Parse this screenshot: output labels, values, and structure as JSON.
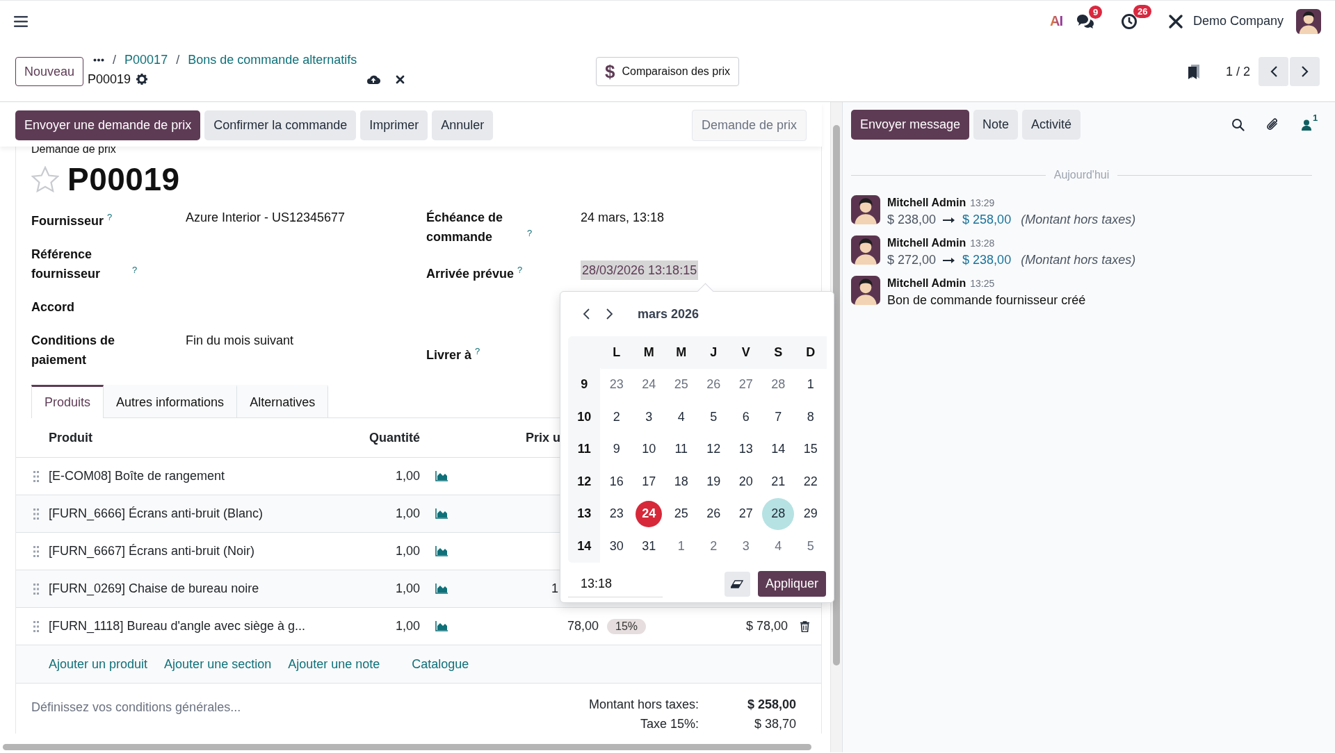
{
  "navbar": {
    "ai_label": "AI",
    "messages_badge": "9",
    "activities_badge": "26",
    "company": "Demo Company"
  },
  "control_panel": {
    "new_button": "Nouveau",
    "breadcrumbs": [
      {
        "kind": "separator",
        "label": "/"
      },
      {
        "kind": "link",
        "label": "P00017"
      },
      {
        "kind": "separator",
        "label": "/"
      },
      {
        "kind": "link",
        "label": "Bons de commande alternatifs"
      }
    ],
    "record_name": "P00019",
    "comparison_button": {
      "icon": "$",
      "label": "Comparaison des prix"
    },
    "pager": "1 / 2"
  },
  "actions": {
    "buttons": [
      {
        "label": "Envoyer une demande de prix",
        "primary": true
      },
      {
        "label": "Confirmer la commande",
        "primary": false
      },
      {
        "label": "Imprimer",
        "primary": false
      },
      {
        "label": "Annuler",
        "primary": false
      }
    ],
    "status": "Demande de prix"
  },
  "form": {
    "state_label": "Demande de prix",
    "starred": false,
    "name": "P00019",
    "fields_left": [
      {
        "label": "Fournisseur",
        "help": "?",
        "value": "Azure Interior - US12345677",
        "focused": false
      },
      {
        "label": "Référence fournisseur",
        "help": "?"
      },
      {
        "label": "Accord"
      },
      {
        "label": "Conditions de paiement",
        "value": "Fin du mois suivant",
        "focused": false
      }
    ],
    "fields_right": [
      {
        "label": "Échéance de commande",
        "help": "?",
        "value": "24 mars, 13:18",
        "focused": false
      },
      {
        "label": "Arrivée prévue",
        "help": "?",
        "value": "28/03/2026 13:18:15",
        "focused": true
      },
      {
        "label": "Livrer à",
        "help": "?"
      }
    ],
    "tabs": [
      {
        "label": "Produits",
        "selected": true
      },
      {
        "label": "Autres informations",
        "selected": false
      },
      {
        "label": "Alternatives",
        "selected": false
      }
    ],
    "columns": [
      "Produit",
      "Quantité",
      "Prix u"
    ],
    "rows": [
      {
        "product": "[E-COM08] Boîte de rangement",
        "quantity": "1,00"
      },
      {
        "product": "[FURN_6666] Écrans anti-bruit (Blanc)",
        "quantity": "1,00"
      },
      {
        "product": "[FURN_6667] Écrans anti-bruit (Noir)",
        "quantity": "1,00"
      },
      {
        "product": "[FURN_0269] Chaise de bureau noire",
        "quantity": "1,00",
        "price": "1"
      },
      {
        "product": "[FURN_1118] Bureau d'angle avec siège à g...",
        "quantity": "1,00",
        "price": "78,00",
        "tax": "15%",
        "subtotal": "$ 78,00"
      }
    ],
    "add_links": [
      "Ajouter un produit",
      "Ajouter une section",
      "Ajouter une note",
      "Catalogue"
    ],
    "notes": {
      "placeholder": "Définissez vos conditions générales..."
    },
    "totals": [
      {
        "label": "Montant hors taxes:",
        "value": "$ 258,00",
        "bold": true
      },
      {
        "label": "Taxe 15%:",
        "value": "$ 38,70",
        "bold": false
      }
    ]
  },
  "date_picker": {
    "month": "mars 2026",
    "weekdays": [
      "L",
      "M",
      "M",
      "J",
      "V",
      "S",
      "D"
    ],
    "weeks": [
      {
        "number": "9",
        "days": [
          {
            "label": "23",
            "outside": true,
            "today": false,
            "selected": false
          },
          {
            "label": "24",
            "outside": true,
            "today": false,
            "selected": false
          },
          {
            "label": "25",
            "outside": true,
            "today": false,
            "selected": false
          },
          {
            "label": "26",
            "outside": true,
            "today": false,
            "selected": false
          },
          {
            "label": "27",
            "outside": true,
            "today": false,
            "selected": false
          },
          {
            "label": "28",
            "outside": true,
            "today": false,
            "selected": false
          },
          {
            "label": "1",
            "outside": false,
            "today": false,
            "selected": false
          }
        ]
      },
      {
        "number": "10",
        "days": [
          {
            "label": "2",
            "outside": false,
            "today": false,
            "selected": false
          },
          {
            "label": "3",
            "outside": false,
            "today": false,
            "selected": false
          },
          {
            "label": "4",
            "outside": false,
            "today": false,
            "selected": false
          },
          {
            "label": "5",
            "outside": false,
            "today": false,
            "selected": false
          },
          {
            "label": "6",
            "outside": false,
            "today": false,
            "selected": false
          },
          {
            "label": "7",
            "outside": false,
            "today": false,
            "selected": false
          },
          {
            "label": "8",
            "outside": false,
            "today": false,
            "selected": false
          }
        ]
      },
      {
        "number": "11",
        "days": [
          {
            "label": "9",
            "outside": false,
            "today": false,
            "selected": false
          },
          {
            "label": "10",
            "outside": false,
            "today": false,
            "selected": false
          },
          {
            "label": "11",
            "outside": false,
            "today": false,
            "selected": false
          },
          {
            "label": "12",
            "outside": false,
            "today": false,
            "selected": false
          },
          {
            "label": "13",
            "outside": false,
            "today": false,
            "selected": false
          },
          {
            "label": "14",
            "outside": false,
            "today": false,
            "selected": false
          },
          {
            "label": "15",
            "outside": false,
            "today": false,
            "selected": false
          }
        ]
      },
      {
        "number": "12",
        "days": [
          {
            "label": "16",
            "outside": false,
            "today": false,
            "selected": false
          },
          {
            "label": "17",
            "outside": false,
            "today": false,
            "selected": false
          },
          {
            "label": "18",
            "outside": false,
            "today": false,
            "selected": false
          },
          {
            "label": "19",
            "outside": false,
            "today": false,
            "selected": false
          },
          {
            "label": "20",
            "outside": false,
            "today": false,
            "selected": false
          },
          {
            "label": "21",
            "outside": false,
            "today": false,
            "selected": false
          },
          {
            "label": "22",
            "outside": false,
            "today": false,
            "selected": false
          }
        ]
      },
      {
        "number": "13",
        "days": [
          {
            "label": "23",
            "outside": false,
            "today": false,
            "selected": false
          },
          {
            "label": "24",
            "outside": false,
            "today": true,
            "selected": false
          },
          {
            "label": "25",
            "outside": false,
            "today": false,
            "selected": false
          },
          {
            "label": "26",
            "outside": false,
            "today": false,
            "selected": false
          },
          {
            "label": "27",
            "outside": false,
            "today": false,
            "selected": false
          },
          {
            "label": "28",
            "outside": false,
            "today": false,
            "selected": true
          },
          {
            "label": "29",
            "outside": false,
            "today": false,
            "selected": false
          }
        ]
      },
      {
        "number": "14",
        "days": [
          {
            "label": "30",
            "outside": false,
            "today": false,
            "selected": false
          },
          {
            "label": "31",
            "outside": false,
            "today": false,
            "selected": false
          },
          {
            "label": "1",
            "outside": true,
            "today": false,
            "selected": false
          },
          {
            "label": "2",
            "outside": true,
            "today": false,
            "selected": false
          },
          {
            "label": "3",
            "outside": true,
            "today": false,
            "selected": false
          },
          {
            "label": "4",
            "outside": true,
            "today": false,
            "selected": false
          },
          {
            "label": "5",
            "outside": true,
            "today": false,
            "selected": false
          }
        ]
      }
    ],
    "time": "13:18",
    "apply": "Appliquer"
  },
  "chatter": {
    "buttons": [
      {
        "label": "Envoyer message",
        "primary": true
      },
      {
        "label": "Note",
        "primary": false
      },
      {
        "label": "Activité",
        "primary": false
      }
    ],
    "followers": "1",
    "date_separator": "Aujourd'hui",
    "messages": [
      {
        "author": "Mitchell Admin",
        "time": "13:29",
        "kind": "tracking",
        "old": "$ 238,00",
        "new": "$ 258,00",
        "field": "(Montant hors taxes)"
      },
      {
        "author": "Mitchell Admin",
        "time": "13:28",
        "kind": "tracking",
        "old": "$ 272,00",
        "new": "$ 238,00",
        "field": "(Montant hors taxes)"
      },
      {
        "author": "Mitchell Admin",
        "time": "13:25",
        "kind": "text",
        "body": "Bon de commande fournisseur créé"
      }
    ]
  }
}
